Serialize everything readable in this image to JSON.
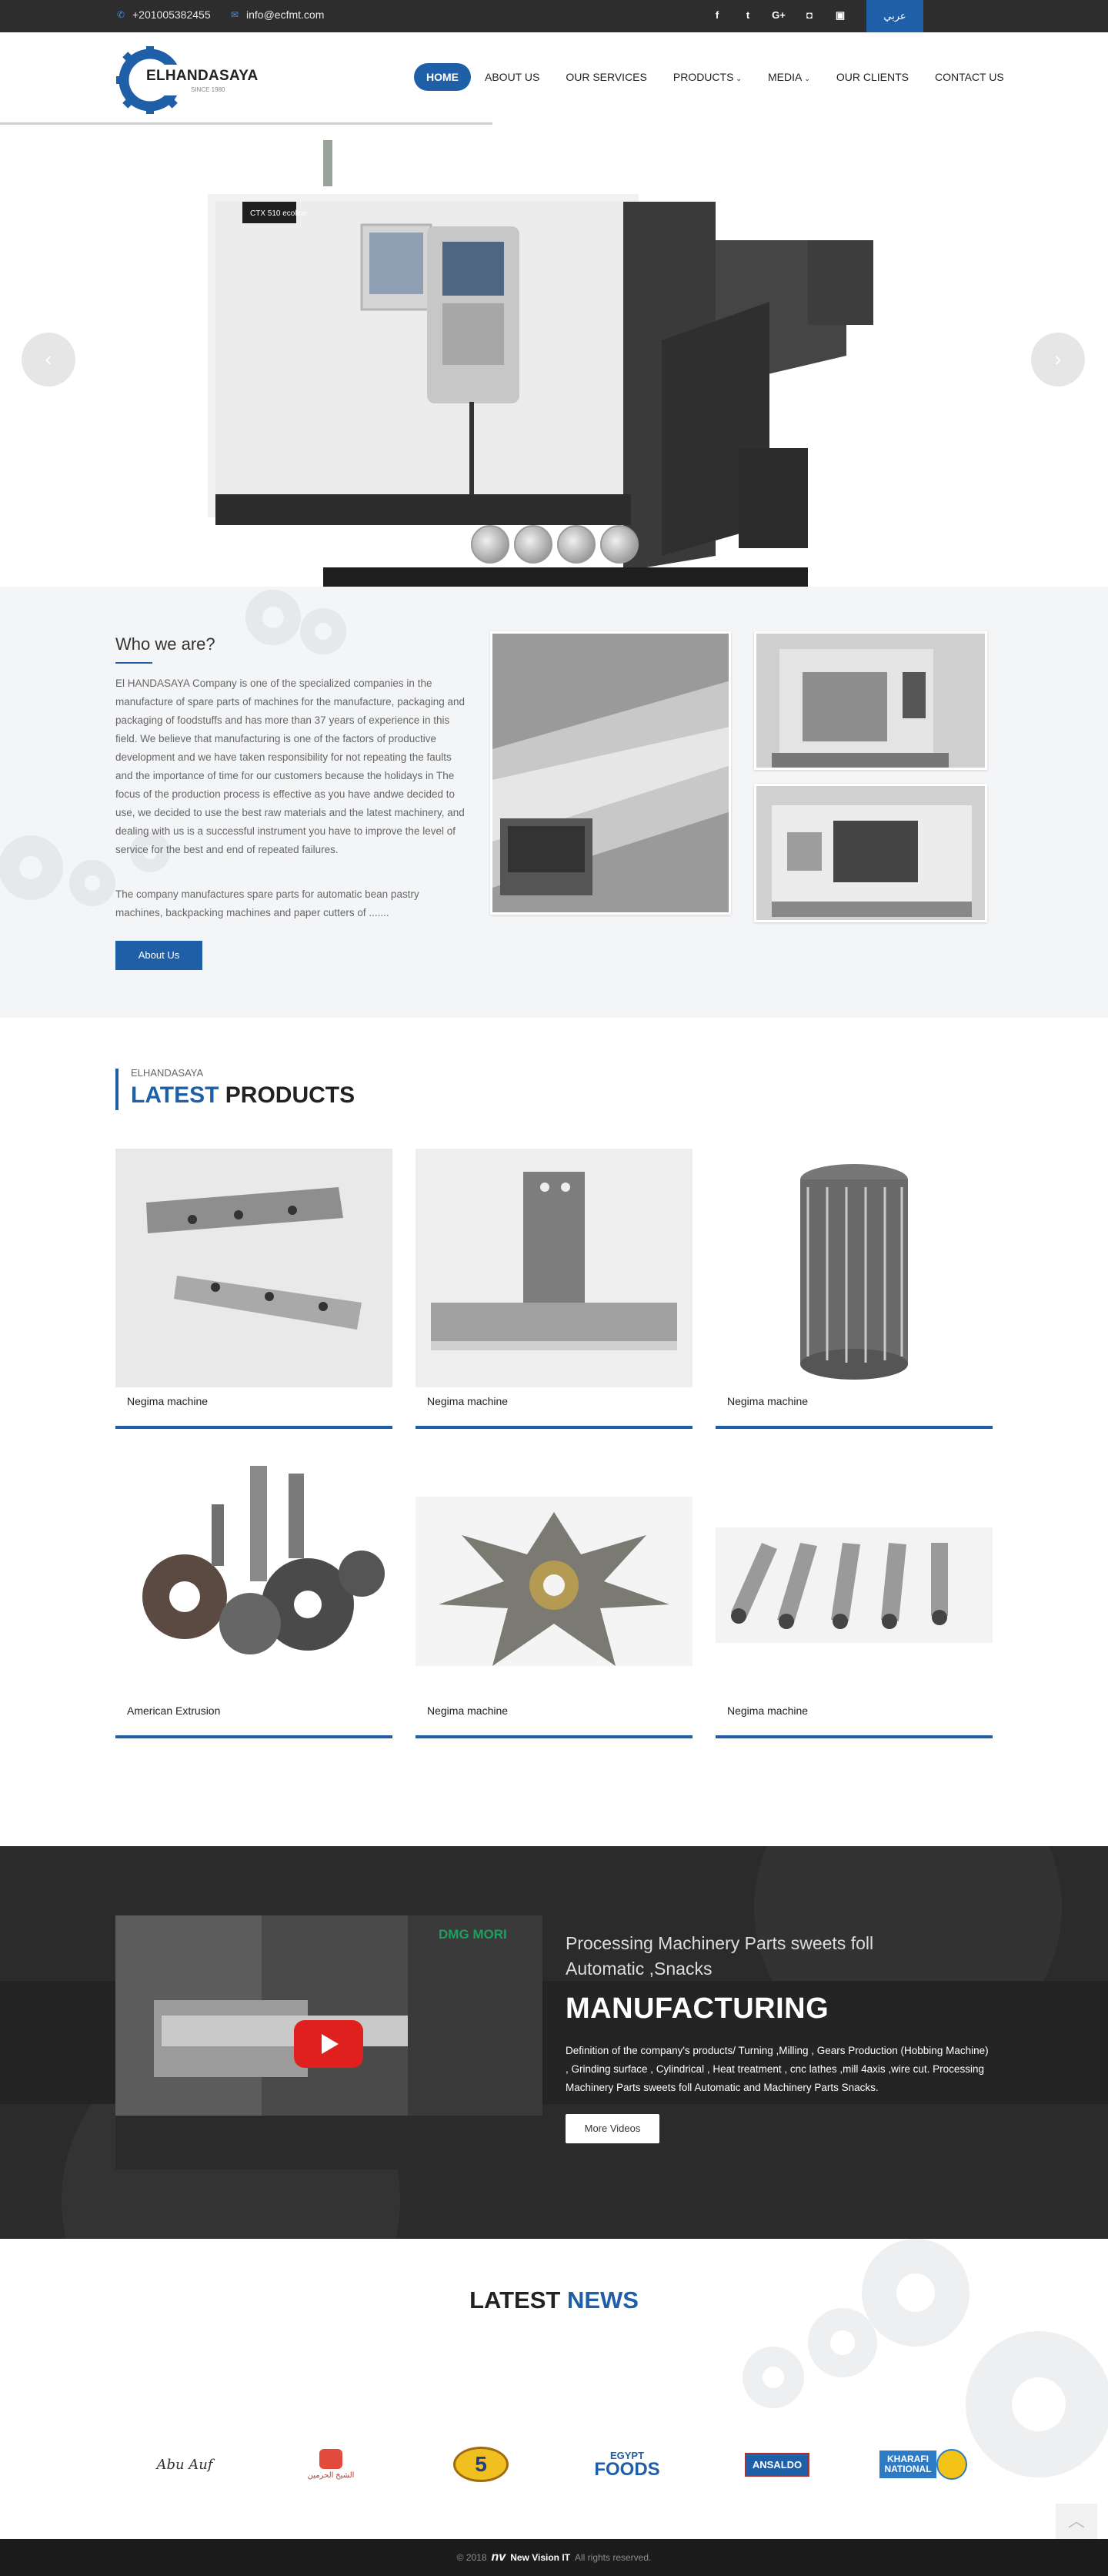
{
  "topbar": {
    "phone": "+201005382455",
    "email": "info@ecfmt.com",
    "social": [
      {
        "icon": "facebook-icon",
        "glyph": "f"
      },
      {
        "icon": "twitter-icon",
        "glyph": "t"
      },
      {
        "icon": "google-plus-icon",
        "glyph": "G+"
      },
      {
        "icon": "instagram-icon",
        "glyph": "◘"
      },
      {
        "icon": "youtube-icon",
        "glyph": "▣"
      }
    ],
    "language_button": "عربي"
  },
  "header": {
    "logo_name": "ELHANDASAYA",
    "logo_since": "SINCE 1980",
    "nav": [
      {
        "label": "HOME",
        "active": true
      },
      {
        "label": "ABOUT US"
      },
      {
        "label": "OUR SERVICES"
      },
      {
        "label": "PRODUCTS",
        "dropdown": true
      },
      {
        "label": "MEDIA",
        "dropdown": true
      },
      {
        "label": "OUR CLIENTS"
      },
      {
        "label": "CONTACT US"
      }
    ],
    "caret": "⌄"
  },
  "slider": {
    "prev": "‹",
    "next": "›",
    "machine_label": "CTX 510 ecoline"
  },
  "about": {
    "title": "Who we are?",
    "paragraph1": "El HANDASAYA  Company is one of the specialized companies in the manufacture of spare parts of machines for the manufacture, packaging and packaging of foodstuffs and has more than 37 years of experience in this field. We believe that manufacturing is one of the factors of productive development and we have taken responsibility for not repeating the faults and the importance of time for our customers because the holidays in The focus of the production process is effective as you have andwe decided to use, we decided to use the best raw materials and the latest machinery, and dealing with us is a successful instrument you have to improve the level of service for the best and end of repeated failures.",
    "paragraph2": "The company manufactures spare parts for automatic bean pastry machines, backpacking machines and paper cutters of .......",
    "button": "About Us"
  },
  "products": {
    "kicker": "ELHANDASAYA",
    "title_blue": "LATEST",
    "title_dark": " PRODUCTS",
    "items": [
      {
        "name": "Negima machine"
      },
      {
        "name": "Negima machine"
      },
      {
        "name": "Negima machine"
      },
      {
        "name": "American Extrusion"
      },
      {
        "name": "Negima machine"
      },
      {
        "name": "Negima machine"
      }
    ]
  },
  "manufacturing": {
    "subtitle": "Processing Machinery Parts sweets foll Automatic ,Snacks",
    "title": "MANUFACTURING",
    "description": "Definition of the company's products/ Turning ,Milling , Gears Production (Hobbing Machine) , Grinding surface , Cylindrical , Heat treatment , cnc lathes ,mill 4axis ,wire cut. Processing Machinery Parts sweets foll Automatic and Machinery Parts Snacks.",
    "button": "More Videos",
    "video_brand": "DMG MORI"
  },
  "news": {
    "title_dark": "LATEST ",
    "title_blue": "NEWS",
    "clients": [
      {
        "name": "Abu Auf"
      },
      {
        "name": "الشيخ الحرمين"
      },
      {
        "name": "5"
      },
      {
        "name": "EGYPT FOODS",
        "line1": "EGYPT",
        "line2": "FOODS"
      },
      {
        "name": "ANSALDO"
      },
      {
        "name": "KHARAFI NATIONAL",
        "line1": "KHARAFI",
        "line2": "NATIONAL"
      }
    ]
  },
  "footer": {
    "copyright": "© 2018",
    "brand_mark": "nv",
    "company": "New Vision IT",
    "rights": "All rights reserved."
  },
  "colors": {
    "brand_blue": "#1f5fa8",
    "topbar_bg": "#2d2d2d",
    "footer_bg": "#1c1c1c"
  }
}
